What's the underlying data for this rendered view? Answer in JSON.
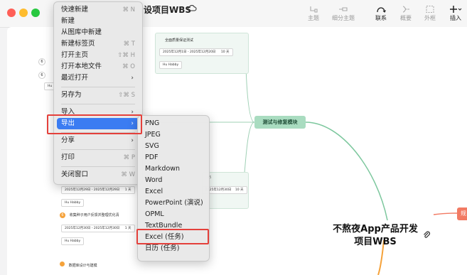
{
  "document_title": "设项目WBS",
  "toolbar": [
    {
      "label": "主题",
      "icon": "topic-icon",
      "active": false
    },
    {
      "label": "细分主题",
      "icon": "subtopic-icon",
      "active": false
    },
    {
      "label": "联系",
      "icon": "relationship-icon",
      "active": true
    },
    {
      "label": "概要",
      "icon": "summary-icon",
      "active": false
    },
    {
      "label": "外框",
      "icon": "boundary-icon",
      "active": false
    },
    {
      "label": "插入",
      "icon": "insert-icon",
      "active": true
    }
  ],
  "main_menu": {
    "items": [
      {
        "label": "快速新建",
        "shortcut": "⌘ N"
      },
      {
        "label": "新建",
        "shortcut": ""
      },
      {
        "label": "从图库中新建",
        "shortcut": ""
      },
      {
        "label": "新建标签页",
        "shortcut": "⌘ T"
      },
      {
        "label": "打开主页",
        "shortcut": "⇧⌘ H"
      },
      {
        "label": "打开本地文件",
        "shortcut": "⌘ O"
      },
      {
        "label": "最近打开",
        "shortcut": "",
        "submenu": true
      },
      {
        "label": "另存为",
        "shortcut": "⇧⌘ S"
      },
      {
        "label": "导入",
        "shortcut": "",
        "submenu": true
      },
      {
        "label": "导出",
        "shortcut": "",
        "submenu": true,
        "highlighted": true
      },
      {
        "label": "分享",
        "shortcut": "",
        "submenu": true
      },
      {
        "label": "打印",
        "shortcut": "⌘ P"
      },
      {
        "label": "关闭窗口",
        "shortcut": "⌘ W"
      }
    ]
  },
  "export_menu": {
    "items": [
      "PNG",
      "JPEG",
      "SVG",
      "PDF",
      "Markdown",
      "Word",
      "Excel",
      "PowerPoint (演说)",
      "OPML",
      "TextBundle",
      "Excel (任务)",
      "日历 (任务)"
    ]
  },
  "mindmap": {
    "central_topic_line1": "不熬夜App产品开发",
    "central_topic_line2": "项目WBS",
    "branch_test": "测试与修复模块",
    "branch_red": "规",
    "task_top": "全面质量保证测试",
    "task_top_date": "2025年12月1日 - 2025年12月20日",
    "task_top_days": "10 天",
    "task_top_owner": "Hu Habby",
    "task_mid_suffix": "布",
    "task_mid_date_a": "2025年12月29日 - 2025年12月29日",
    "task_mid_days_a": "1 天",
    "task_mid_date_b": "2025年12月30日",
    "task_mid_days_b": "10 天",
    "task_mid_owner": "Hu Habby",
    "task_feedback": "收集种子用户反馈并整理优化清",
    "task_feedback_date": "2025年12月30日 - 2025年12月30日",
    "task_feedback_days": "1 天",
    "task_feedback_owner": "Hu Habby",
    "task_db": "数据库设计与建模",
    "left_badge_a": "6",
    "left_badge_b": "6",
    "left_owner_short": "Hu",
    "feedback_badge": "6"
  },
  "colors": {
    "highlight": "#3b7cf2",
    "annotation_red": "#e4403b",
    "branch_green": "#a9dcc0",
    "branch_orange": "#f27a63"
  }
}
